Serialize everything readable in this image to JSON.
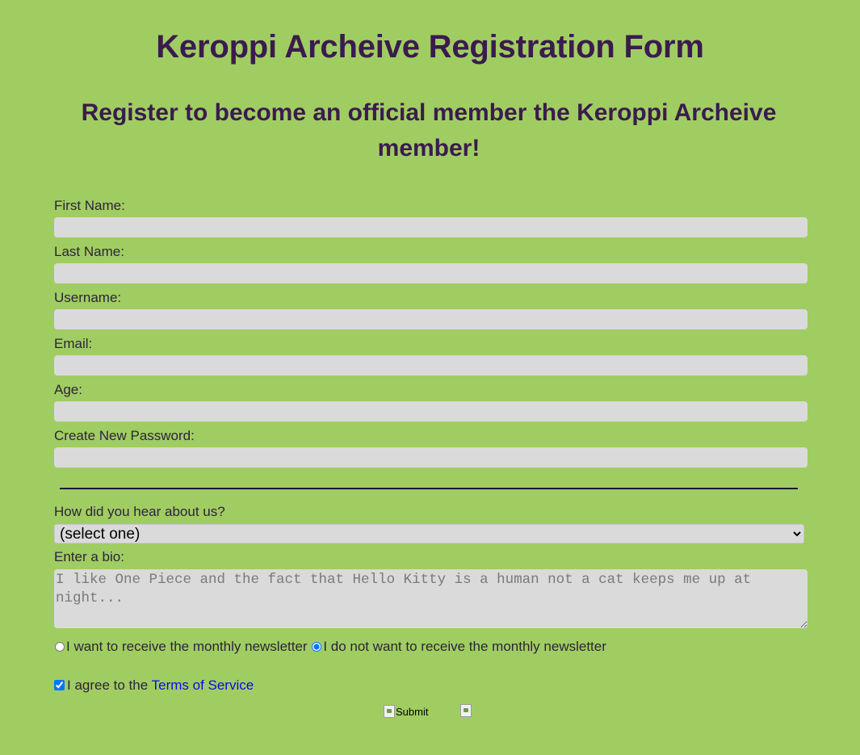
{
  "page": {
    "title": "Keroppi Archeive Registration Form",
    "subtitle": "Register to become an official member the Keroppi Archeive member!"
  },
  "colors": {
    "background": "#a0cd62",
    "heading": "#3b1b4e",
    "input_bg": "#dadada",
    "link": "#0a0ae6"
  },
  "fields": [
    {
      "label": "First Name:",
      "value": ""
    },
    {
      "label": "Last Name:",
      "value": ""
    },
    {
      "label": "Username:",
      "value": ""
    },
    {
      "label": "Email:",
      "value": ""
    },
    {
      "label": "Age:",
      "value": ""
    },
    {
      "label": "Create New Password:",
      "value": ""
    }
  ],
  "source_question": {
    "label": "How did you hear about us?",
    "selected": "(select one)"
  },
  "bio": {
    "label": "Enter a bio:",
    "placeholder": "I like One Piece and the fact that Hello Kitty is a human not a cat keeps me up at night..."
  },
  "newsletter": {
    "option_yes": "I want to receive the monthly newsletter",
    "option_no": "I do not want to receive the monthly newsletter",
    "selected": "no"
  },
  "terms": {
    "text": "I agree to the",
    "link_text": "Terms of Service",
    "checked": true
  },
  "buttons": {
    "submit_alt": "Submit",
    "submit_icon": "broken-image-icon",
    "reset_icon": "broken-image-icon"
  }
}
